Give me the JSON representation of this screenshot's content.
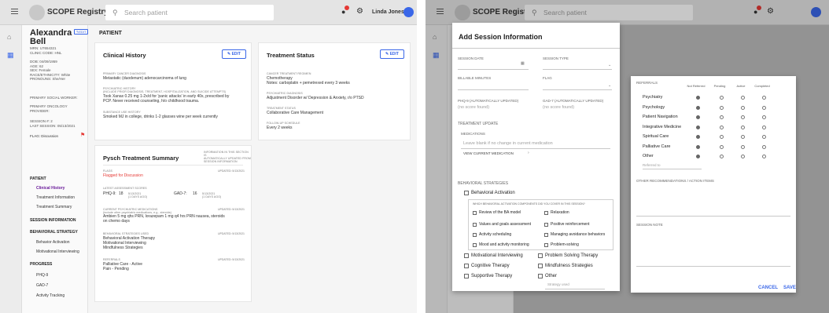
{
  "app": {
    "title": "SCOPE Registry",
    "search_placeholder": "Search patient",
    "user_name": "Linda Jones",
    "notif_count": "2"
  },
  "patient": {
    "first": "Alexandra",
    "last": "Bell",
    "edit": "EDIT",
    "info1": [
      "MRN: U7654321",
      "CLINIC CODE: HNL"
    ],
    "info2": [
      "DOB: 04/09/1959",
      "AGE: 62",
      "SEX: Female",
      "RACE/ETHNICITY: White",
      "PRONOUNS: She/Her"
    ],
    "social": "PRIMARY SOCIAL WORKER:",
    "oncology": [
      "PRIMARY ONCOLOGY",
      "PROVIDER:"
    ],
    "session": [
      "SESSION #: 2",
      "LAST SESSION: 05/13/2021"
    ],
    "flag": "FLAG: Discussion"
  },
  "nav": {
    "patient": "PATIENT",
    "clinical": "Clinical History",
    "treatment_info": "Treatment Information",
    "treatment_summary": "Treatment Summary",
    "session_info": "SESSION INFORMATION",
    "behavioral": "BEHAVIORAL STRATEGY",
    "ba": "Behavior Activation",
    "mi": "Motivational Interviewing",
    "progress": "PROGRESS",
    "phq": "PHQ-9",
    "gad": "GAD-7",
    "activity": "Activity Tracking"
  },
  "main": {
    "page_title": "PATIENT",
    "edit": "EDIT"
  },
  "clinical": {
    "title": "Clinical History",
    "dx_label": "PRIMARY CANCER DIAGNOSIS",
    "dx": "Metastatic (duodenum) adenocarcinoma of lung",
    "psych_label1": "PSYCHIATRIC HISTORY",
    "psych_label2": "(INCLUDE PRIOR DIAGNOSIS, TREATMENT, HOSPITALIZATION, AND SUICIDE ATTEMPTS)",
    "psych1": "Took Xanax 0.25 mg 1-2x/d for 'panic attacks' in early 40s, prescribed by",
    "psych2": "PCP. Never received counseling, h/o childhood trauma.",
    "sub_label": "SUBSTANCE USE HISTORY",
    "sub": "Smoked MJ in college, drinks 1-2 glasses wine per week currently"
  },
  "status": {
    "title": "Treatment Status",
    "regimen_label": "CANCER TREATMENT REGIMEN",
    "regimen1": "Chemotherapy",
    "regimen2": "Notes: carboplatin + pemetrexed every 3 weeks",
    "dx_label": "PSYCHIATRIC DIAGNOSIS",
    "dx": "Adjustment Disorder w/ Depression & Anxiety, r/o PTSD",
    "ts_label": "TREATMENT STATUS",
    "ts": "Collaborative Care Management",
    "fu_label": "FOLLOW-UP SCHEDULE",
    "fu": "Every 2 weeks"
  },
  "summary": {
    "title": "Pysch Treatment Summary",
    "note": [
      "INFORMATION IN THIS SECTION IS",
      "AUTOMATICALLY UPDATED FROM",
      "SESSION INFORMATION"
    ],
    "flags_label": "FLAGS",
    "updated": "UPDATED: 5/13/2021",
    "flags": "Flagged for Discussion",
    "scores_label": "LATEST ASSESSMENT SCORES",
    "phq_label": "PHQ-9:",
    "phq": "18",
    "phq_date": "5/13/2021",
    "phq_ago": "(1 days ago)",
    "gad_label": "GAD-7:",
    "gad": "16",
    "gad_date": "5/13/2021",
    "gad_ago": "(1 days ago)",
    "meds_label": "CURRENT PSYCHIATRIC MEDICATIONS",
    "meds_sub": "(include other psychiatric medications, e.g., steroids)",
    "meds1": "Ambien 5 mg qhs PRN, lorazepam 1 mg q4 hrs PRN nausea, steroids",
    "meds2": "on chemo days",
    "bs_label": "BEHAVIORAL STRATEGIES USED",
    "bs": [
      "Behavioral Activation Therapy",
      "Motivational Interviewing",
      "Mindfulness Strategies"
    ],
    "ref_label": "REFERRALS",
    "ref": [
      "Palliative Care - Active",
      "Pain - Pending"
    ]
  },
  "session": {
    "title": "Add Session Information",
    "date": "SESSION DATE",
    "type": "SESSION TYPE",
    "minutes": "BILLABLE MINUTES",
    "flag": "FLAG",
    "phq_label": "PHQ-9 (AUTOMATICALLY UPDATED)",
    "gad_label": "GAD-7 (AUTOMATICALLY UPDATED)",
    "no_score": "(no score found)",
    "tu": "TREATMENT UPDATE",
    "meds": "MEDICATIONS",
    "meds_placeholder": "Leave blank if no change in current medication",
    "view_meds": "VIEW CURRENT MEDICATION",
    "bs": "BEHAVIORAL STRATEGIES",
    "ba": "Behavioral Activation",
    "ba_q": "WHICH BEHAVIORAL ACTIVATION COMPONENTS DID YOU COVER IN THIS SESSION?",
    "ba_items_left": [
      "Review of the BA model",
      "Values and goals assessment",
      "Activity scheduling",
      "Mood and activity monitoring"
    ],
    "ba_items_right": [
      "Relaxation",
      "Positive reinforcement",
      "Managing avoidance behaviors",
      "Problem-solving"
    ],
    "bs_left": [
      "Motivational Interviewing",
      "Cognitive Therapy",
      "Supportive Therapy"
    ],
    "bs_right": [
      "Problem Solving Therapy",
      "Mindfulness Strategies",
      "Other"
    ],
    "strategy_used": "Strategy used"
  },
  "referrals": {
    "label": "REFERRALS",
    "cols": [
      "Not Referred",
      "Pending",
      "Active",
      "Completed"
    ],
    "rows": [
      "Psychiatry",
      "Psychology",
      "Patient Navigation",
      "Integrative Medicine",
      "Spiritual Care",
      "Palliative Care",
      "Other"
    ],
    "selected": [
      0,
      0,
      0,
      0,
      0,
      0,
      0
    ],
    "referred_to": "Referred to",
    "other_label": "OTHER RECOMMENDATIONS / ACTION ITEMS",
    "note_label": "SESSION NOTE",
    "cancel": "CANCEL",
    "save": "SAVE"
  },
  "colors": {
    "accent": "#3a67e8",
    "flag": "#e53935",
    "purple": "#6a1b9a"
  }
}
